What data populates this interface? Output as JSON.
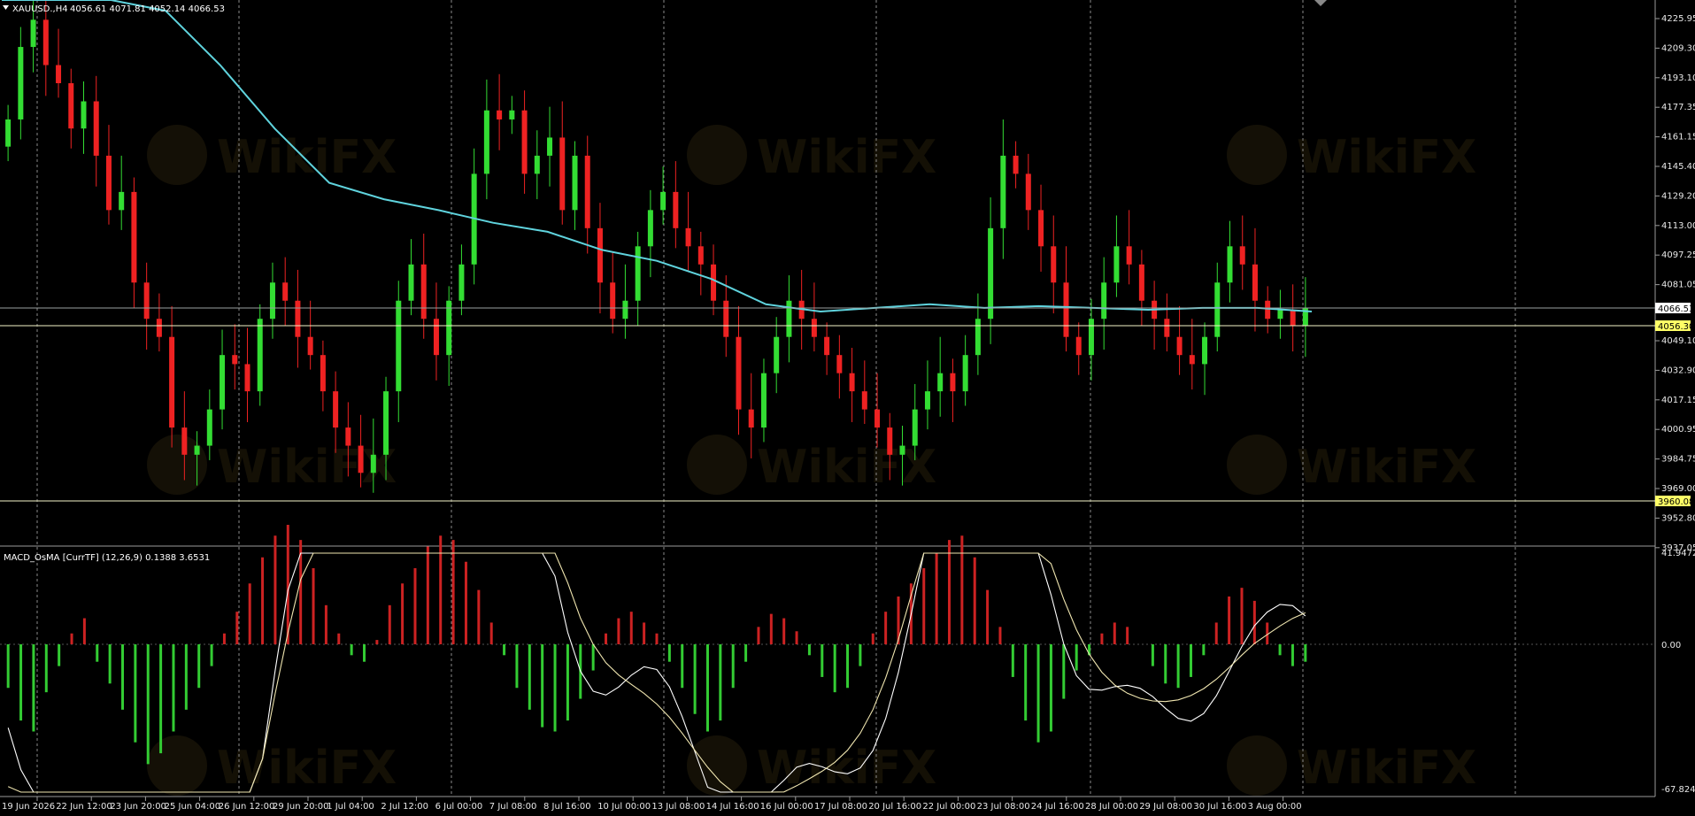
{
  "header": {
    "symbol": "XAUUSD.,H4",
    "ohlc": "4056.61 4071.81 4052.14 4066.53",
    "dropdown_icon": "triangle-down-icon"
  },
  "indicator": {
    "label": "MACD_OsMA [CurrTF] (12,26,9) 0.1388 3.6531"
  },
  "price_axis": {
    "ticks": [
      "4225.95",
      "4209.30",
      "4193.10",
      "4177.35",
      "4161.15",
      "4145.40",
      "4129.20",
      "4113.00",
      "4097.25",
      "4081.05",
      "4049.10",
      "4032.90",
      "4017.15",
      "4000.95",
      "3984.75",
      "3969.00",
      "3952.80",
      "3937.05"
    ],
    "bid_tag": "4066.53",
    "level_1_tag": "4056.30",
    "level_2_tag": "3960.08"
  },
  "macd_axis": {
    "ticks": [
      "41.9472",
      "0.00",
      "-67.8247"
    ]
  },
  "time_axis": {
    "labels": [
      "19 Jun 2026",
      "22 Jun 12:00",
      "23 Jun 20:00",
      "25 Jun 04:00",
      "26 Jun 12:00",
      "29 Jun 20:00",
      "1 Jul 04:00",
      "2 Jul 12:00",
      "6 Jul 00:00",
      "7 Jul 08:00",
      "8 Jul 16:00",
      "10 Jul 00:00",
      "13 Jul 08:00",
      "14 Jul 16:00",
      "16 Jul 00:00",
      "17 Jul 08:00",
      "20 Jul 16:00",
      "22 Jul 00:00",
      "23 Jul 08:00",
      "24 Jul 16:00",
      "28 Jul 00:00",
      "29 Jul 08:00",
      "30 Jul 16:00",
      "3 Aug 00:00"
    ]
  },
  "watermark": {
    "text": "WikiFX"
  },
  "colors": {
    "background": "#000000",
    "bull_candle": "#33dd33",
    "bear_candle": "#ee2222",
    "moving_average": "#5fd3dd",
    "hist_positive": "#cc2222",
    "hist_negative": "#33cc33",
    "macd_line": "#ffffff",
    "signal_line": "#f0e6b0",
    "level_line": "#f5f5c8",
    "grid": "#8a8a8a"
  },
  "chart_data": {
    "type": "candlestick",
    "symbol": "XAUUSD.",
    "timeframe": "H4",
    "y_range": [
      3937.05,
      4232
    ],
    "levels": [
      4066.53,
      4056.3,
      3960.08
    ],
    "moving_average_points": [
      [
        0,
        4330
      ],
      [
        4,
        4300
      ],
      [
        8,
        4255
      ],
      [
        12,
        4230
      ],
      [
        16,
        4200
      ],
      [
        20,
        4165
      ],
      [
        24,
        4135
      ],
      [
        28,
        4126
      ],
      [
        32,
        4120
      ],
      [
        36,
        4113
      ],
      [
        40,
        4108
      ],
      [
        44,
        4098
      ],
      [
        48,
        4092
      ],
      [
        52,
        4082
      ],
      [
        56,
        4068
      ],
      [
        60,
        4064
      ],
      [
        64,
        4066
      ],
      [
        68,
        4068
      ],
      [
        72,
        4066
      ],
      [
        76,
        4067
      ],
      [
        80,
        4066
      ],
      [
        84,
        4065
      ],
      [
        88,
        4066
      ],
      [
        92,
        4066
      ],
      [
        96,
        4064
      ]
    ],
    "candles_close": [
      4170,
      4210,
      4225,
      4200,
      4190,
      4165,
      4180,
      4150,
      4120,
      4130,
      4080,
      4060,
      4050,
      4000,
      3985,
      3990,
      4010,
      4040,
      4035,
      4020,
      4060,
      4080,
      4070,
      4050,
      4040,
      4020,
      4000,
      3990,
      3975,
      3985,
      4020,
      4070,
      4090,
      4060,
      4040,
      4070,
      4090,
      4140,
      4175,
      4170,
      4175,
      4140,
      4150,
      4160,
      4120,
      4150,
      4110,
      4080,
      4060,
      4070,
      4100,
      4120,
      4130,
      4110,
      4100,
      4090,
      4070,
      4050,
      4010,
      4000,
      4030,
      4050,
      4070,
      4060,
      4050,
      4040,
      4030,
      4020,
      4010,
      4000,
      3985,
      3990,
      4010,
      4020,
      4030,
      4020,
      4040,
      4060,
      4110,
      4150,
      4140,
      4120,
      4100,
      4080,
      4050,
      4040,
      4060,
      4080,
      4100,
      4090,
      4070,
      4060,
      4050,
      4040,
      4035,
      4050,
      4080,
      4100,
      4090,
      4070,
      4060,
      4065,
      4056,
      4066
    ],
    "macd_hist": [
      -20,
      -35,
      -40,
      -22,
      -10,
      5,
      12,
      -8,
      -18,
      -30,
      -45,
      -55,
      -50,
      -40,
      -30,
      -20,
      -10,
      5,
      15,
      28,
      40,
      50,
      55,
      48,
      35,
      18,
      5,
      -5,
      -8,
      2,
      18,
      28,
      35,
      45,
      50,
      48,
      38,
      25,
      10,
      -5,
      -20,
      -30,
      -38,
      -40,
      -35,
      -25,
      -12,
      5,
      12,
      15,
      10,
      5,
      -8,
      -20,
      -32,
      -40,
      -35,
      -20,
      -8,
      8,
      14,
      12,
      6,
      -5,
      -15,
      -22,
      -20,
      -10,
      5,
      15,
      22,
      28,
      35,
      42,
      48,
      50,
      40,
      25,
      8,
      -15,
      -35,
      -45,
      -40,
      -25,
      -12,
      -5,
      5,
      10,
      8,
      0,
      -10,
      -18,
      -20,
      -15,
      -5,
      10,
      22,
      26,
      20,
      10,
      -5,
      -10,
      -8
    ],
    "macd_axis_range": [
      -67.8247,
      41.9472
    ],
    "indicator_values": {
      "main": 0.1388,
      "signal": 3.6531
    }
  }
}
